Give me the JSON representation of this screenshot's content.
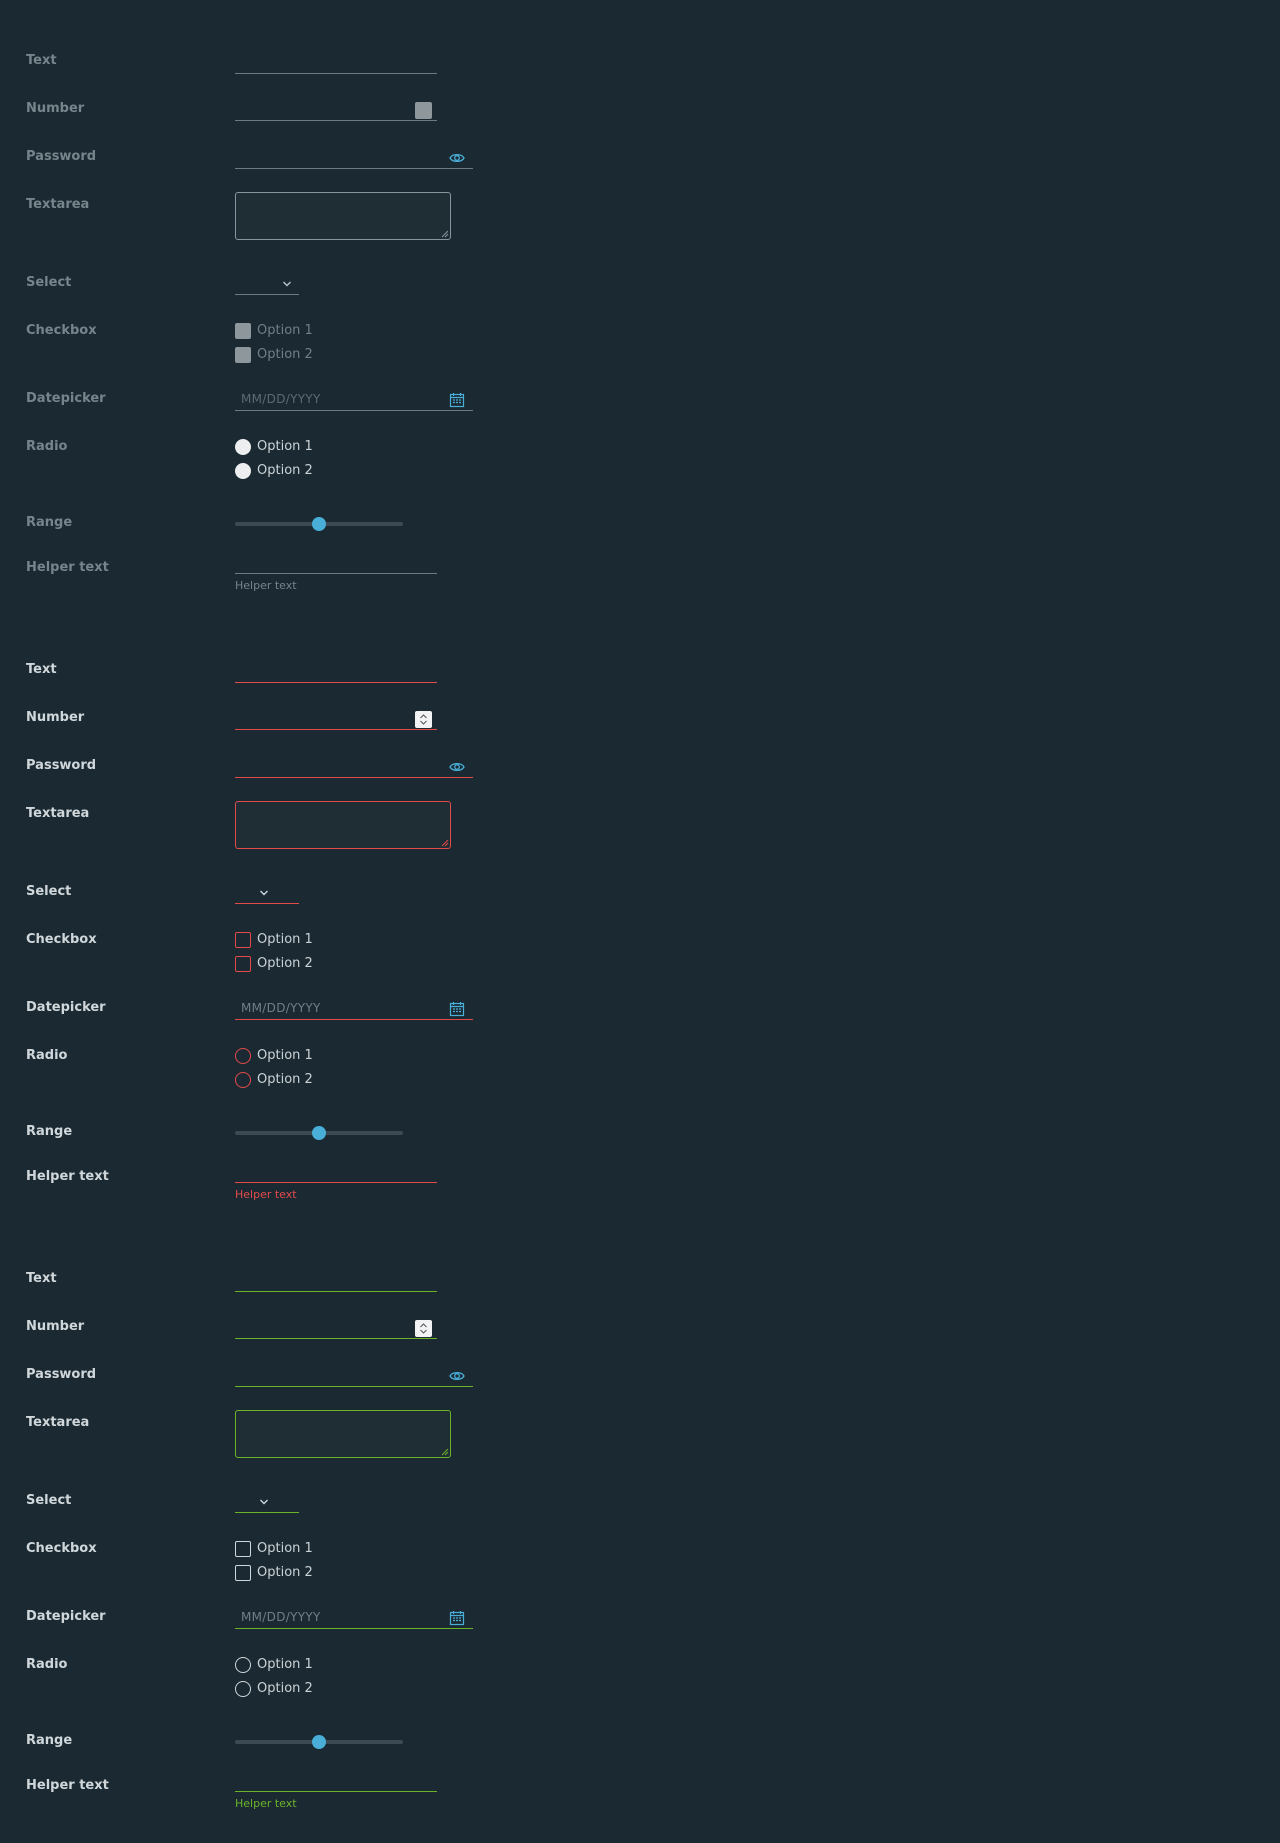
{
  "sections": [
    {
      "state": "disabled",
      "labels": {
        "text": "Text",
        "number": "Number",
        "password": "Password",
        "textarea": "Textarea",
        "select": "Select",
        "checkbox": "Checkbox",
        "datepicker": "Datepicker",
        "radio": "Radio",
        "range": "Range",
        "helper": "Helper text"
      },
      "checkbox_options": [
        "Option 1",
        "Option 2"
      ],
      "radio_options": [
        "Option 1",
        "Option 2"
      ],
      "date_placeholder": "MM/DD/YYYY",
      "range_value": 0.5,
      "helper_text": "Helper text",
      "state_color": "#6b7a82"
    },
    {
      "state": "error",
      "labels": {
        "text": "Text",
        "number": "Number",
        "password": "Password",
        "textarea": "Textarea",
        "select": "Select",
        "checkbox": "Checkbox",
        "datepicker": "Datepicker",
        "radio": "Radio",
        "range": "Range",
        "helper": "Helper text"
      },
      "checkbox_options": [
        "Option 1",
        "Option 2"
      ],
      "radio_options": [
        "Option 1",
        "Option 2"
      ],
      "date_placeholder": "MM/DD/YYYY",
      "range_value": 0.5,
      "helper_text": "Helper text",
      "state_color": "#e34a4a"
    },
    {
      "state": "success",
      "labels": {
        "text": "Text",
        "number": "Number",
        "password": "Password",
        "textarea": "Textarea",
        "select": "Select",
        "checkbox": "Checkbox",
        "datepicker": "Datepicker",
        "radio": "Radio",
        "range": "Range",
        "helper": "Helper text"
      },
      "checkbox_options": [
        "Option 1",
        "Option 2"
      ],
      "radio_options": [
        "Option 1",
        "Option 2"
      ],
      "date_placeholder": "MM/DD/YYYY",
      "range_value": 0.5,
      "helper_text": "Helper text",
      "state_color": "#6bb42a"
    }
  ],
  "icons": {
    "password_toggle": "eye-icon",
    "datepicker_toggle": "calendar-icon",
    "select_arrow": "chevron-down-icon",
    "number_spinner": "spinner-arrows-icon",
    "textarea_resize": "resize-handle-icon"
  },
  "colors": {
    "background": "#1b2a32",
    "accent": "#49afd9",
    "label": "#d0d7db"
  }
}
